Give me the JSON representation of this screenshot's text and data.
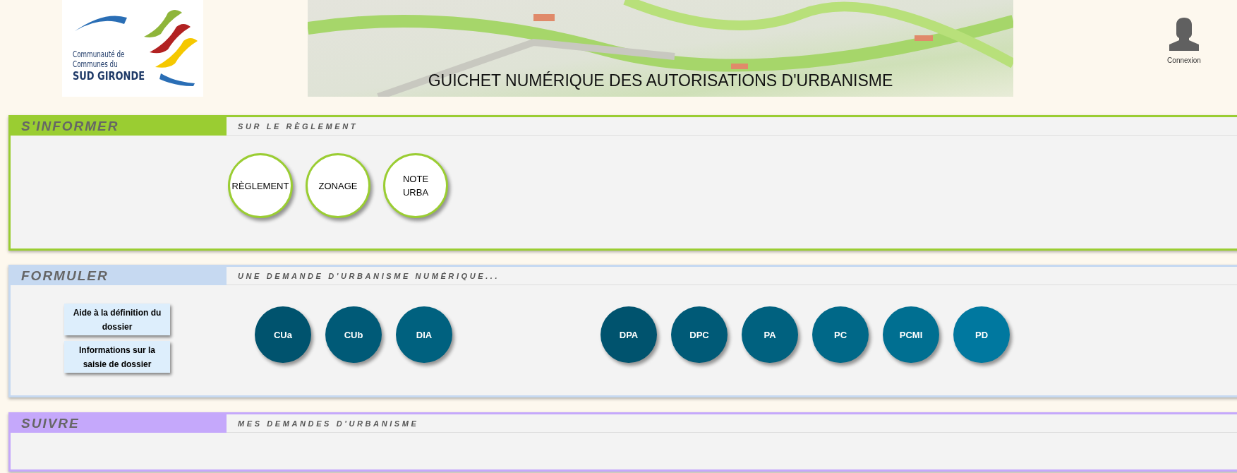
{
  "logo": {
    "lines": [
      "Communauté de",
      "Communes du",
      "SUD GIRONDE"
    ]
  },
  "banner": {
    "title": "GUICHET NUMÉRIQUE DES AUTORISATIONS D'URBANISME"
  },
  "user": {
    "label": "Connexion"
  },
  "sections": [
    {
      "kind": "informer",
      "title": "S'INFORMER",
      "subtitle": "SUR LE RÈGLEMENT",
      "color": "#9acd32",
      "circle_groups": [
        [
          {
            "label": "RÈGLEMENT"
          },
          {
            "label": "ZONAGE"
          },
          {
            "label": "NOTE URBA"
          }
        ]
      ]
    },
    {
      "kind": "formuler",
      "title": "FORMULER",
      "subtitle": "UNE DEMANDE D'URBANISME NUMÉRIQUE...",
      "color": "#c6d9f1",
      "side_buttons": [
        "Aide à la définition du dossier",
        "Informations sur la saisie de dossier"
      ],
      "circle_groups": [
        [
          {
            "label": "CUa",
            "color": "#00536e"
          },
          {
            "label": "CUb",
            "color": "#005a77"
          },
          {
            "label": "DIA",
            "color": "#00617f"
          }
        ],
        [
          {
            "label": "DPA",
            "color": "#00536e"
          },
          {
            "label": "DPC",
            "color": "#005a77"
          },
          {
            "label": "PA",
            "color": "#00617f"
          },
          {
            "label": "PC",
            "color": "#006888"
          },
          {
            "label": "PCMI",
            "color": "#006f91"
          },
          {
            "label": "PD",
            "color": "#00789f"
          }
        ]
      ]
    },
    {
      "kind": "suivre",
      "title": "SUIVRE",
      "subtitle": "MES DEMANDES D'URBANISME",
      "color": "#c5a8fb"
    }
  ]
}
